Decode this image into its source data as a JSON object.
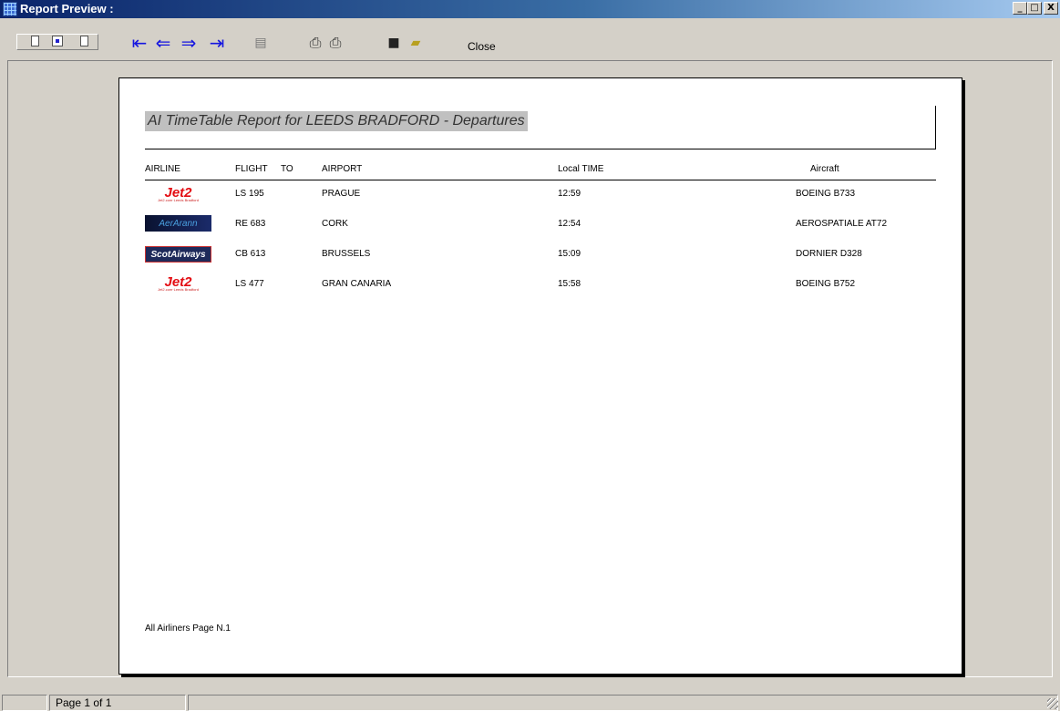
{
  "window": {
    "title": "Report Preview :",
    "controls": {
      "minimize": "_",
      "maximize": "□",
      "close": "X"
    }
  },
  "toolbar": {
    "first_icon": "⇤",
    "prev_icon": "⇐",
    "next_icon": "⇒",
    "last_icon": "⇥",
    "goto_icon": "▤",
    "print_setup_icon": "⎙",
    "print_icon": "⎙",
    "save_icon": "■",
    "open_icon": "▰",
    "close_label": "Close",
    "icons": [
      "one-page-icon",
      "two-page-icon",
      "page-width-icon",
      "first-page-icon",
      "prev-page-icon",
      "next-page-icon",
      "last-page-icon",
      "goto-page-icon",
      "print-setup-icon",
      "print-icon",
      "save-icon",
      "open-folder-icon"
    ]
  },
  "report": {
    "title": "AI TimeTable Report for LEEDS BRADFORD - Departures",
    "columns": {
      "airline": "AIRLINE",
      "flight": "FLIGHT",
      "to": "TO",
      "airport": "AIRPORT",
      "local_time": "Local TIME",
      "aircraft": "Aircraft"
    },
    "rows": [
      {
        "logo": "Jet2",
        "logo_sub": "Jet2.com·Leeds Bradford",
        "flight": "LS 195",
        "airport": "PRAGUE",
        "time": "12:59",
        "aircraft": "BOEING B733"
      },
      {
        "logo": "AerArann",
        "flight": "RE 683",
        "airport": "CORK",
        "time": "12:54",
        "aircraft": "AEROSPATIALE AT72"
      },
      {
        "logo": "ScotAirways",
        "flight": "CB 613",
        "airport": "BRUSSELS",
        "time": "15:09",
        "aircraft": "DORNIER D328"
      },
      {
        "logo": "Jet2",
        "logo_sub": "Jet2.com·Leeds Bradford",
        "flight": "LS 477",
        "airport": "GRAN CANARIA",
        "time": "15:58",
        "aircraft": "BOEING B752"
      }
    ],
    "footer": "All Airliners Page N.1"
  },
  "status": {
    "page_info": "Page 1 of 1"
  },
  "colors": {
    "title_gradient_start": "#0a246a",
    "arrow_blue": "#1515e0",
    "jet2_red": "#e30d13"
  }
}
